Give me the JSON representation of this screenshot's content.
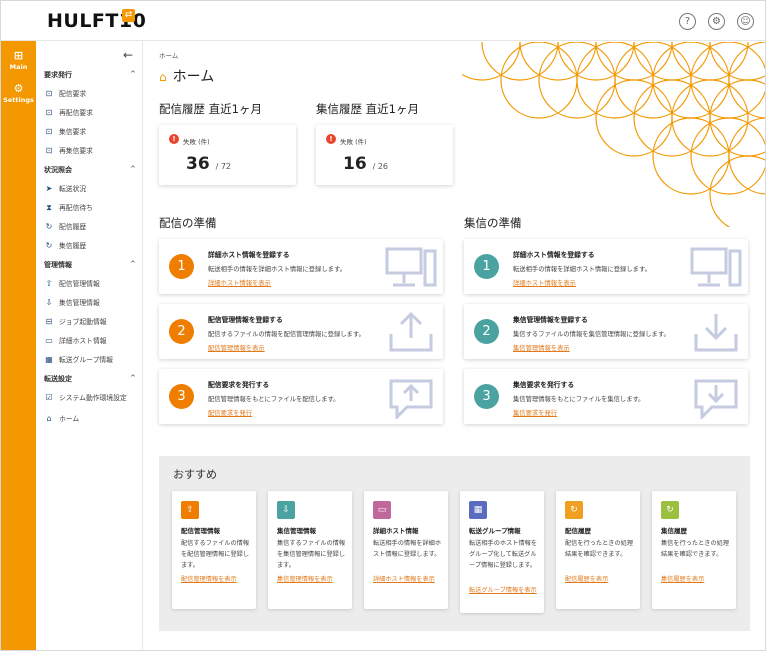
{
  "header": {
    "logo": "HULFT10",
    "logo_badge": "⇄",
    "help_icon": "?",
    "org_icon": "⚙",
    "user_icon": "☺"
  },
  "rail": {
    "items": [
      {
        "label": "Main",
        "icon": "grid-icon"
      },
      {
        "label": "Settings",
        "icon": "gear-icon"
      }
    ]
  },
  "sidebar": {
    "collapse": "←",
    "sections": [
      {
        "title": "要求発行",
        "items": [
          "配信要求",
          "再配信要求",
          "集信要求",
          "再集信要求"
        ]
      },
      {
        "title": "状況照会",
        "items": [
          "転送状況",
          "再配信待ち",
          "配信履歴",
          "集信履歴"
        ]
      },
      {
        "title": "管理情報",
        "items": [
          "配信管理情報",
          "集信管理情報",
          "ジョブ起動情報",
          "詳細ホスト情報",
          "転送グループ情報"
        ]
      },
      {
        "title": "転送設定",
        "items": [
          "システム動作環境設定"
        ]
      }
    ],
    "home": "ホーム"
  },
  "main": {
    "breadcrumb": "ホーム",
    "title": "ホーム",
    "send_history_title": "配信履歴 直近1ヶ月",
    "recv_history_title": "集信履歴 直近1ヶ月",
    "send_stat": {
      "label": "失敗 (件)",
      "value": "36",
      "total": "/ 72"
    },
    "recv_stat": {
      "label": "失敗 (件)",
      "value": "16",
      "total": "/ 26"
    },
    "send_prep_title": "配信の準備",
    "recv_prep_title": "集信の準備",
    "send_cards": [
      {
        "num": "1",
        "title": "詳細ホスト情報を登録する",
        "desc": "転送相手の情報を詳細ホスト情報に登録します。",
        "link": "詳細ホスト情報を表示"
      },
      {
        "num": "2",
        "title": "配信管理情報を登録する",
        "desc": "配信するファイルの情報を配信管理情報に登録します。",
        "link": "配信管理情報を表示"
      },
      {
        "num": "3",
        "title": "配信要求を発行する",
        "desc": "配信管理情報をもとにファイルを配信します。",
        "link": "配信要求を発行"
      }
    ],
    "recv_cards": [
      {
        "num": "1",
        "title": "詳細ホスト情報を登録する",
        "desc": "転送相手の情報を詳細ホスト情報に登録します。",
        "link": "詳細ホスト情報を表示"
      },
      {
        "num": "2",
        "title": "集信管理情報を登録する",
        "desc": "集信するファイルの情報を集信管理情報に登録します。",
        "link": "集信管理情報を表示"
      },
      {
        "num": "3",
        "title": "集信要求を発行する",
        "desc": "集信管理情報をもとにファイルを集信します。",
        "link": "集信要求を発行"
      }
    ],
    "colors": {
      "brand": "#f39800",
      "send": "#ef7d00",
      "recv": "#4aa3a0",
      "link": "#e07a1b"
    }
  },
  "recommend": {
    "title": "おすすめ",
    "cards": [
      {
        "title": "配信管理情報",
        "desc": "配信するファイルの情報を配信管理情報に登録します。",
        "link": "配信管理情報を表示",
        "color": "#ef7d00"
      },
      {
        "title": "集信管理情報",
        "desc": "集信するファイルの情報を集信管理情報に登録します。",
        "link": "集信管理情報を表示",
        "color": "#4aa3a0"
      },
      {
        "title": "詳細ホスト情報",
        "desc": "転送相手の情報を詳細ホスト情報に登録します。",
        "link": "詳細ホスト情報を表示",
        "color": "#c0679b"
      },
      {
        "title": "転送グループ情報",
        "desc": "転送相手のホスト情報をグループ化して転送グループ情報に登録します。",
        "link": "転送グループ情報を表示",
        "color": "#5b6cc0"
      },
      {
        "title": "配信履歴",
        "desc": "配信を行ったときの処理結果を確認できます。",
        "link": "配信履歴を表示",
        "color": "#f0a020"
      },
      {
        "title": "集信履歴",
        "desc": "集信を行ったときの処理結果を確認できます。",
        "link": "集信履歴を表示",
        "color": "#9bbf3f"
      }
    ]
  }
}
